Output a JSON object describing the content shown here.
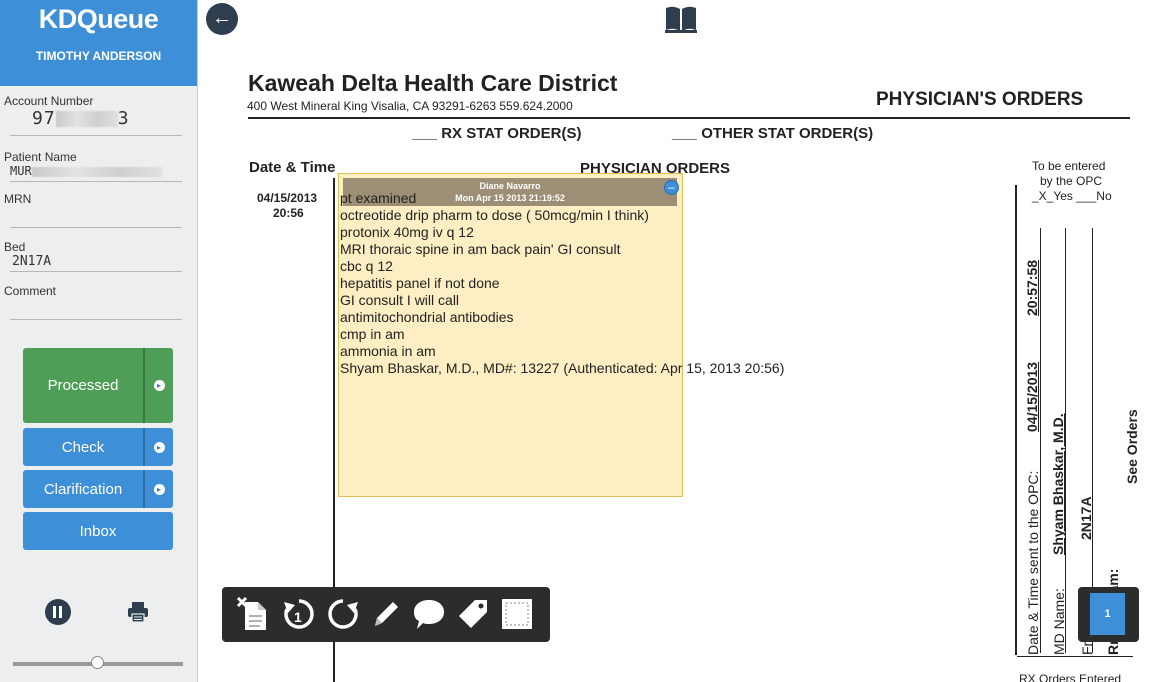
{
  "app": {
    "name": "KDQueue",
    "user": "TIMOTHY ANDERSON"
  },
  "patient": {
    "account_label": "Account Number",
    "account_value_start": "97",
    "account_value_end": "3",
    "name_label": "Patient Name",
    "name_value_start": "MUR",
    "mrn_label": "MRN",
    "mrn_value": "",
    "bed_label": "Bed",
    "bed_value": "2N17A",
    "comment_label": "Comment",
    "comment_value": ""
  },
  "actions": {
    "processed": "Processed",
    "check": "Check",
    "clarification": "Clarification",
    "inbox": "Inbox"
  },
  "slider": {
    "value": 0.5
  },
  "document": {
    "org_name": "Kaweah Delta Health Care District",
    "org_address": "400 West Mineral King  Visalia, CA  93291-6263  559.624.2000",
    "form_title": "PHYSICIAN'S ORDERS",
    "rx_stat": "___ RX STAT ORDER(S)",
    "other_stat": "___ OTHER STAT ORDER(S)",
    "col_date_time": "Date & Time",
    "col_orders": "PHYSICIAN ORDERS",
    "to_be_entered_1": "To be entered",
    "to_be_entered_2": "by the OPC",
    "yes_no": "_X_Yes  ___No",
    "entry_date": "04/15/2013",
    "entry_time": "20:56",
    "orders": [
      "pt examined",
      "octreotide drip pharm to dose ( 50mcg/min I think)",
      "protonix 40mg iv q 12",
      "MRI thoraic spine in am  back pain' GI consult",
      "cbc q 12",
      "hepatitis panel if not done",
      "GI consult I will call",
      "antimitochondrial antibodies",
      "cmp in am",
      "ammonia in am",
      "Shyam Bhaskar, M.D., MD#: 13227  (Authenticated: Apr 15, 2013 20:56)"
    ],
    "side_date_time_label": "Date & Time sent to the OPC:",
    "side_date": "04/15/2013",
    "side_time": "20:57:58",
    "side_md_label": "MD Name:",
    "side_md_name": "Shyam Bhaskar, M.D.",
    "side_from_label": "From:",
    "side_room": "2N17A",
    "side_prior_exam": "Rm or Exam:",
    "side_see_orders": "See Orders",
    "rx_orders_entered": "RX Orders Entered"
  },
  "note": {
    "author": "Diane Navarro",
    "timestamp": "Mon Apr 15 2013 21:19:52"
  },
  "toolbar": {
    "tools": [
      "delete-page-icon",
      "rotate-left-icon",
      "rotate-right-icon",
      "pen-icon",
      "comment-icon",
      "tag-icon",
      "stamp-icon"
    ]
  },
  "pager": {
    "page": "1"
  }
}
